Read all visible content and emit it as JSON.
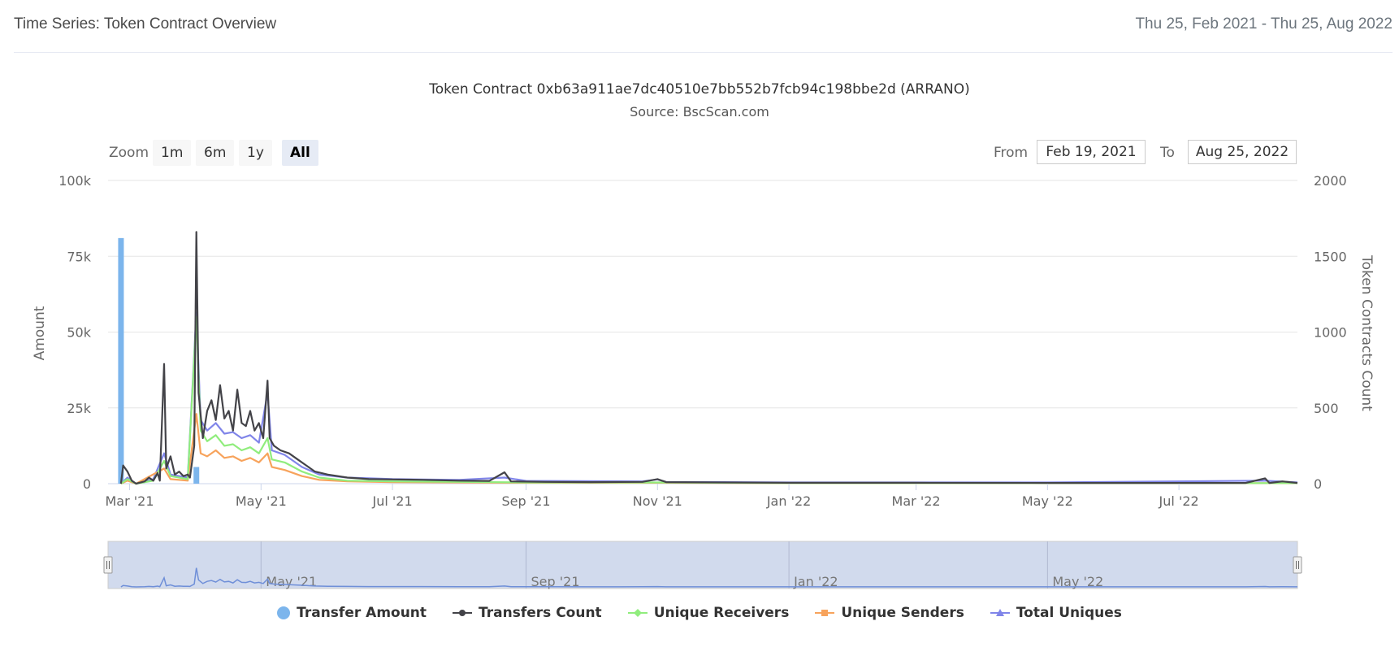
{
  "header": {
    "title": "Time Series: Token Contract Overview",
    "date_range": "Thu 25, Feb 2021 - Thu 25, Aug 2022"
  },
  "zoom": {
    "label": "Zoom",
    "buttons": [
      "1m",
      "6m",
      "1y",
      "All"
    ],
    "active": "All"
  },
  "range": {
    "from_label": "From",
    "from_value": "Feb 19, 2021",
    "to_label": "To",
    "to_value": "Aug 25, 2022"
  },
  "colors": {
    "transfer_amount": "#7cb5ec",
    "transfers_count": "#434348",
    "unique_receivers": "#90ed7d",
    "unique_senders": "#f7a35c",
    "total_uniques": "#8085e9"
  },
  "chart_data": {
    "type": "line",
    "title": "Token Contract 0xb63a911ae7dc40510e7bb552b7fcb94c198bbe2d (ARRANO)",
    "subtitle": "Source: BscScan.com",
    "ylabel_left": "Amount",
    "ylabel_right": "Token Contracts Count",
    "ylim_left": [
      0,
      100000
    ],
    "ylim_right": [
      0,
      2000
    ],
    "yticks_left": [
      "0",
      "25k",
      "50k",
      "75k",
      "100k"
    ],
    "yticks_right": [
      "0",
      "500",
      "1000",
      "1500",
      "2000"
    ],
    "xlim": [
      "2021-02-19",
      "2022-08-25"
    ],
    "xticks": [
      {
        "date": "2021-03-01",
        "label": "Mar '21"
      },
      {
        "date": "2021-05-01",
        "label": "May '21"
      },
      {
        "date": "2021-07-01",
        "label": "Jul '21"
      },
      {
        "date": "2021-09-01",
        "label": "Sep '21"
      },
      {
        "date": "2021-11-01",
        "label": "Nov '21"
      },
      {
        "date": "2022-01-01",
        "label": "Jan '22"
      },
      {
        "date": "2022-03-01",
        "label": "Mar '22"
      },
      {
        "date": "2022-05-01",
        "label": "May '22"
      },
      {
        "date": "2022-07-01",
        "label": "Jul '22"
      }
    ],
    "navigator_ticks": [
      {
        "date": "2021-05-01",
        "label": "May '21"
      },
      {
        "date": "2021-09-01",
        "label": "Sep '21"
      },
      {
        "date": "2022-01-01",
        "label": "Jan '22"
      },
      {
        "date": "2022-05-01",
        "label": "May '22"
      }
    ],
    "grid": true,
    "legend_position": "bottom",
    "series": [
      {
        "name": "Transfer Amount",
        "type": "column",
        "axis": "left",
        "points": [
          [
            "2021-02-25",
            81000
          ],
          [
            "2021-04-01",
            5500
          ]
        ]
      },
      {
        "name": "Transfers Count",
        "type": "line",
        "axis": "right",
        "points": [
          [
            "2021-02-25",
            0
          ],
          [
            "2021-02-26",
            120
          ],
          [
            "2021-02-28",
            80
          ],
          [
            "2021-03-02",
            20
          ],
          [
            "2021-03-04",
            0
          ],
          [
            "2021-03-08",
            15
          ],
          [
            "2021-03-10",
            40
          ],
          [
            "2021-03-12",
            20
          ],
          [
            "2021-03-14",
            70
          ],
          [
            "2021-03-15",
            20
          ],
          [
            "2021-03-17",
            790
          ],
          [
            "2021-03-18",
            100
          ],
          [
            "2021-03-20",
            180
          ],
          [
            "2021-03-22",
            60
          ],
          [
            "2021-03-24",
            80
          ],
          [
            "2021-03-26",
            50
          ],
          [
            "2021-03-28",
            60
          ],
          [
            "2021-03-29",
            40
          ],
          [
            "2021-03-31",
            250
          ],
          [
            "2021-04-01",
            1660
          ],
          [
            "2021-04-02",
            600
          ],
          [
            "2021-04-04",
            300
          ],
          [
            "2021-04-06",
            480
          ],
          [
            "2021-04-08",
            550
          ],
          [
            "2021-04-10",
            420
          ],
          [
            "2021-04-12",
            650
          ],
          [
            "2021-04-14",
            430
          ],
          [
            "2021-04-16",
            480
          ],
          [
            "2021-04-18",
            350
          ],
          [
            "2021-04-20",
            620
          ],
          [
            "2021-04-22",
            400
          ],
          [
            "2021-04-24",
            380
          ],
          [
            "2021-04-26",
            480
          ],
          [
            "2021-04-28",
            350
          ],
          [
            "2021-04-30",
            400
          ],
          [
            "2021-05-02",
            300
          ],
          [
            "2021-05-04",
            680
          ],
          [
            "2021-05-05",
            300
          ],
          [
            "2021-05-07",
            250
          ],
          [
            "2021-05-10",
            220
          ],
          [
            "2021-05-14",
            200
          ],
          [
            "2021-05-18",
            160
          ],
          [
            "2021-05-22",
            120
          ],
          [
            "2021-05-26",
            80
          ],
          [
            "2021-06-01",
            60
          ],
          [
            "2021-06-10",
            40
          ],
          [
            "2021-06-20",
            30
          ],
          [
            "2021-07-01",
            28
          ],
          [
            "2021-07-15",
            25
          ],
          [
            "2021-08-01",
            20
          ],
          [
            "2021-08-15",
            18
          ],
          [
            "2021-08-22",
            75
          ],
          [
            "2021-08-25",
            15
          ],
          [
            "2021-09-10",
            12
          ],
          [
            "2021-10-01",
            10
          ],
          [
            "2021-10-25",
            12
          ],
          [
            "2021-11-01",
            30
          ],
          [
            "2021-11-05",
            10
          ],
          [
            "2021-12-01",
            8
          ],
          [
            "2022-01-01",
            6
          ],
          [
            "2022-03-01",
            6
          ],
          [
            "2022-05-01",
            5
          ],
          [
            "2022-07-01",
            5
          ],
          [
            "2022-08-01",
            5
          ],
          [
            "2022-08-10",
            35
          ],
          [
            "2022-08-12",
            5
          ],
          [
            "2022-08-18",
            15
          ],
          [
            "2022-08-25",
            5
          ]
        ]
      },
      {
        "name": "Unique Receivers",
        "type": "line",
        "axis": "right",
        "points": [
          [
            "2021-02-25",
            0
          ],
          [
            "2021-02-28",
            30
          ],
          [
            "2021-03-04",
            0
          ],
          [
            "2021-03-12",
            20
          ],
          [
            "2021-03-17",
            150
          ],
          [
            "2021-03-20",
            50
          ],
          [
            "2021-03-28",
            30
          ],
          [
            "2021-04-01",
            1100
          ],
          [
            "2021-04-03",
            350
          ],
          [
            "2021-04-06",
            280
          ],
          [
            "2021-04-10",
            320
          ],
          [
            "2021-04-14",
            250
          ],
          [
            "2021-04-18",
            260
          ],
          [
            "2021-04-22",
            220
          ],
          [
            "2021-04-26",
            240
          ],
          [
            "2021-04-30",
            200
          ],
          [
            "2021-05-04",
            300
          ],
          [
            "2021-05-06",
            160
          ],
          [
            "2021-05-12",
            140
          ],
          [
            "2021-05-20",
            80
          ],
          [
            "2021-05-28",
            40
          ],
          [
            "2021-06-10",
            20
          ],
          [
            "2021-07-01",
            15
          ],
          [
            "2021-08-01",
            12
          ],
          [
            "2021-09-01",
            8
          ],
          [
            "2021-11-01",
            8
          ],
          [
            "2022-01-01",
            4
          ],
          [
            "2022-05-01",
            4
          ],
          [
            "2022-08-25",
            4
          ]
        ]
      },
      {
        "name": "Unique Senders",
        "type": "line",
        "axis": "right",
        "points": [
          [
            "2021-02-25",
            0
          ],
          [
            "2021-02-28",
            20
          ],
          [
            "2021-03-04",
            0
          ],
          [
            "2021-03-17",
            100
          ],
          [
            "2021-03-20",
            30
          ],
          [
            "2021-03-28",
            20
          ],
          [
            "2021-04-01",
            460
          ],
          [
            "2021-04-03",
            200
          ],
          [
            "2021-04-06",
            180
          ],
          [
            "2021-04-10",
            220
          ],
          [
            "2021-04-14",
            170
          ],
          [
            "2021-04-18",
            180
          ],
          [
            "2021-04-22",
            150
          ],
          [
            "2021-04-26",
            170
          ],
          [
            "2021-04-30",
            140
          ],
          [
            "2021-05-04",
            200
          ],
          [
            "2021-05-06",
            110
          ],
          [
            "2021-05-12",
            90
          ],
          [
            "2021-05-20",
            50
          ],
          [
            "2021-05-28",
            25
          ],
          [
            "2021-06-10",
            15
          ],
          [
            "2021-07-01",
            10
          ],
          [
            "2021-08-01",
            8
          ],
          [
            "2021-09-01",
            6
          ],
          [
            "2021-11-01",
            6
          ],
          [
            "2022-01-01",
            3
          ],
          [
            "2022-05-01",
            3
          ],
          [
            "2022-08-25",
            3
          ]
        ]
      },
      {
        "name": "Total Uniques",
        "type": "line",
        "axis": "right",
        "points": [
          [
            "2021-02-25",
            0
          ],
          [
            "2021-02-28",
            40
          ],
          [
            "2021-03-04",
            0
          ],
          [
            "2021-03-12",
            30
          ],
          [
            "2021-03-17",
            200
          ],
          [
            "2021-03-20",
            60
          ],
          [
            "2021-03-28",
            40
          ],
          [
            "2021-04-01",
            1130
          ],
          [
            "2021-04-03",
            420
          ],
          [
            "2021-04-06",
            350
          ],
          [
            "2021-04-10",
            400
          ],
          [
            "2021-04-14",
            330
          ],
          [
            "2021-04-18",
            340
          ],
          [
            "2021-04-22",
            300
          ],
          [
            "2021-04-26",
            320
          ],
          [
            "2021-04-30",
            270
          ],
          [
            "2021-05-04",
            600
          ],
          [
            "2021-05-06",
            220
          ],
          [
            "2021-05-12",
            190
          ],
          [
            "2021-05-20",
            110
          ],
          [
            "2021-05-28",
            60
          ],
          [
            "2021-06-10",
            40
          ],
          [
            "2021-07-01",
            30
          ],
          [
            "2021-08-01",
            25
          ],
          [
            "2021-08-22",
            40
          ],
          [
            "2021-09-01",
            18
          ],
          [
            "2021-10-25",
            15
          ],
          [
            "2021-11-01",
            28
          ],
          [
            "2021-11-05",
            12
          ],
          [
            "2022-01-01",
            8
          ],
          [
            "2022-05-01",
            8
          ],
          [
            "2022-08-10",
            20
          ],
          [
            "2022-08-25",
            8
          ]
        ]
      }
    ]
  }
}
